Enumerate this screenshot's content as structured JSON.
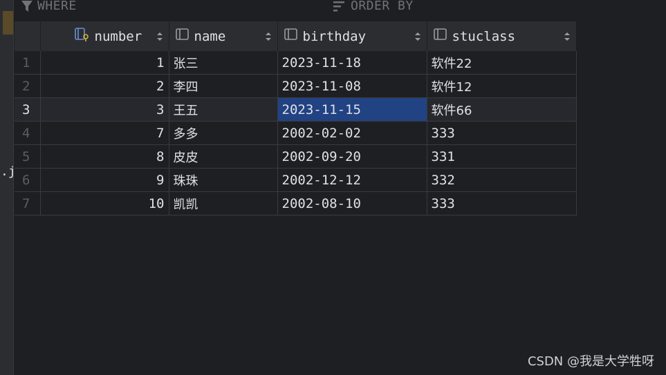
{
  "left_strip": {
    "fragment": ".ja"
  },
  "filter_bar": {
    "where_label": "WHERE",
    "orderby_label": "ORDER BY"
  },
  "table": {
    "columns": [
      {
        "label": "number",
        "icon": "primary-key-column-icon"
      },
      {
        "label": "name",
        "icon": "column-icon"
      },
      {
        "label": "birthday",
        "icon": "column-icon"
      },
      {
        "label": "stuclass",
        "icon": "column-icon"
      }
    ],
    "rows": [
      {
        "rownum": "1",
        "number": "1",
        "name": "张三",
        "birthday": "2023-11-18",
        "stuclass": "软件22"
      },
      {
        "rownum": "2",
        "number": "2",
        "name": "李四",
        "birthday": "2023-11-08",
        "stuclass": "软件12"
      },
      {
        "rownum": "3",
        "number": "3",
        "name": "王五",
        "birthday": "2023-11-15",
        "stuclass": "软件66"
      },
      {
        "rownum": "4",
        "number": "7",
        "name": "多多",
        "birthday": "2002-02-02",
        "stuclass": "333"
      },
      {
        "rownum": "5",
        "number": "8",
        "name": "皮皮",
        "birthday": "2002-09-20",
        "stuclass": "331"
      },
      {
        "rownum": "6",
        "number": "9",
        "name": "珠珠",
        "birthday": "2002-12-12",
        "stuclass": "332"
      },
      {
        "rownum": "7",
        "number": "10",
        "name": "凯凯",
        "birthday": "2002-08-10",
        "stuclass": "333"
      }
    ],
    "current_row": 3,
    "selected_cell": "birthday"
  },
  "watermark": "CSDN @我是大学牲呀",
  "colors": {
    "background": "#1e1f22",
    "header": "#2b2d30",
    "selection": "#214283"
  }
}
